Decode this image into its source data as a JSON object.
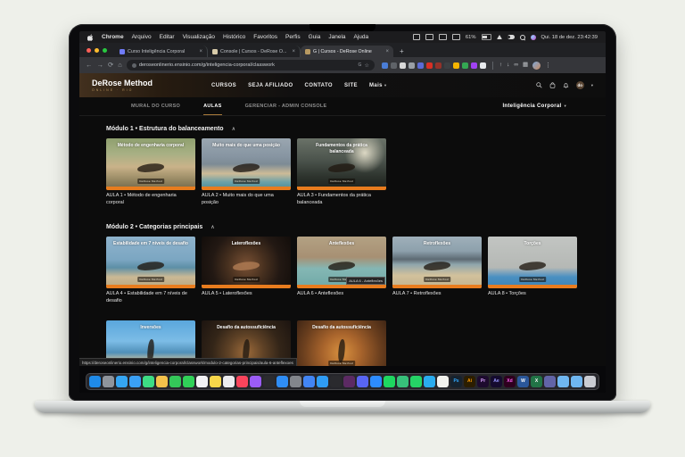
{
  "colors": {
    "accent_orange": "#e87c1e",
    "accent_gold": "#a87a3a"
  },
  "menubar": {
    "items": [
      "Chrome",
      "Arquivo",
      "Editar",
      "Visualização",
      "Histórico",
      "Favoritos",
      "Perfis",
      "Guia",
      "Janela",
      "Ajuda"
    ],
    "battery_pct": "61%",
    "clock": "Qui. 18 de dez. 23:42:39"
  },
  "browser": {
    "tabs": [
      {
        "title": "Curso Inteligência Corporal",
        "favicon": "#6f7bf7",
        "active": false
      },
      {
        "title": "Console | Cursos - DeRose O...",
        "favicon": "#d8cba9",
        "active": false
      },
      {
        "title": "G | Cursos - DeRose Online",
        "favicon": "#b89a62",
        "active": true
      }
    ],
    "url": "deroseonlinerio.ensinio.com/g/inteligencia-corporal/classwork",
    "key_hint": "G",
    "status_url": "https://deroseonlinerio.ensinio.com/g/inteligencia-corporal/classwork/modulo-2-categorias-principais/aula-6-anteflexoes",
    "extensions": [
      {
        "name": "ext-blue",
        "color": "#4a7dd6"
      },
      {
        "name": "ext-slate",
        "color": "#5f6368"
      },
      {
        "name": "ext-pencil",
        "color": "#d8d8d8"
      },
      {
        "name": "ext-gray",
        "color": "#9aa0a6"
      },
      {
        "name": "ext-indigo",
        "color": "#5b6bd6"
      },
      {
        "name": "ext-red",
        "color": "#d93025"
      },
      {
        "name": "ext-maroon",
        "color": "#93322a"
      },
      {
        "name": "ext-dark",
        "color": "#3c4043"
      },
      {
        "name": "ext-amber",
        "color": "#f4b400"
      },
      {
        "name": "ext-green",
        "color": "#34a853"
      },
      {
        "name": "ext-purple",
        "color": "#a142f4"
      },
      {
        "name": "ext-white",
        "color": "#e8eaed"
      }
    ]
  },
  "icons": {
    "back": "←",
    "forward": "→",
    "reload": "⟳",
    "home": "⌂",
    "new_tab": "+",
    "menu": "⋮",
    "star": "☆",
    "collapse": "∧",
    "dropdown": "▾",
    "share": "↑",
    "download": "↓",
    "link": "∞",
    "grid": "▦",
    "close": "×"
  },
  "site": {
    "logo": "DeRose Method",
    "logo_sub": "ONLINE · RIO",
    "nav": [
      "CURSOS",
      "SEJA AFILIADO",
      "CONTATO",
      "SITE"
    ],
    "more_label": "Mais",
    "avatar_label": "do",
    "course_tabs": [
      {
        "label": "MURAL DO CURSO",
        "active": false
      },
      {
        "label": "AULAS",
        "active": true
      },
      {
        "label": "GERENCIAR - ADMIN CONSOLE",
        "active": false
      }
    ],
    "course_selector": "Inteligência Corporal",
    "watermark": "DeRose Method",
    "modules": [
      {
        "title": "Módulo 1 • Estrutura do balanceamento",
        "lessons": [
          {
            "caption": "AULA 1 • Método de engenharia corporal",
            "thumb_title": "Método de engenharia corporal",
            "style": "t1",
            "tooltip": ""
          },
          {
            "caption": "AULA 2 • Muito mais do que uma posição",
            "thumb_title": "Muito mais do que uma posição",
            "style": "t2",
            "tooltip": ""
          },
          {
            "caption": "AULA 3 • Fundamentos da prática balanceada",
            "thumb_title": "Fundamentos da prática balanceada",
            "style": "t3",
            "tooltip": ""
          }
        ]
      },
      {
        "title": "Módulo 2 • Categorias principais",
        "lessons": [
          {
            "caption": "AULA 4 • Estabilidade em 7 níveis de desafio",
            "thumb_title": "Estabilidade em 7 níveis de desafio",
            "style": "t4",
            "tooltip": ""
          },
          {
            "caption": "AULA 5 • Lateroflexões",
            "thumb_title": "Lateroflexões",
            "style": "t5",
            "tooltip": ""
          },
          {
            "caption": "AULA 6 • Anteflexões",
            "thumb_title": "Anteflexões",
            "style": "t6",
            "tooltip": "AULA 6 - Anteflexões"
          },
          {
            "caption": "AULA 7 • Retroflexões",
            "thumb_title": "Retroflexões",
            "style": "t7",
            "tooltip": ""
          },
          {
            "caption": "AULA 8 • Torções",
            "thumb_title": "Torções",
            "style": "t8",
            "tooltip": ""
          },
          {
            "caption": "",
            "thumb_title": "Inversões",
            "style": "t9",
            "tooltip": ""
          },
          {
            "caption": "",
            "thumb_title": "Desafio da autossuficiência",
            "style": "t10",
            "tooltip": ""
          },
          {
            "caption": "",
            "thumb_title": "Desafio da autossuficiência",
            "style": "t11",
            "tooltip": ""
          }
        ]
      }
    ]
  },
  "dock": {
    "icons": [
      {
        "name": "finder",
        "color": "#1f8ae8"
      },
      {
        "name": "launchpad",
        "color": "#8f949c"
      },
      {
        "name": "safari",
        "color": "#35a5f2"
      },
      {
        "name": "mail",
        "color": "#3aa0f5"
      },
      {
        "name": "maps",
        "color": "#3ddc84"
      },
      {
        "name": "photos",
        "color": "#f3c14b"
      },
      {
        "name": "messages",
        "color": "#34c759"
      },
      {
        "name": "facetime",
        "color": "#30d158"
      },
      {
        "name": "calendar",
        "color": "#f2f2f4"
      },
      {
        "name": "notes",
        "color": "#f7d64a"
      },
      {
        "name": "reminders",
        "color": "#ececf0"
      },
      {
        "name": "music",
        "color": "#fa445c"
      },
      {
        "name": "podcasts",
        "color": "#9b5cf6"
      },
      {
        "name": "tv",
        "color": "#2b2b2e"
      },
      {
        "name": "appstore",
        "color": "#2f8df5"
      },
      {
        "name": "settings",
        "color": "#83868c"
      },
      {
        "name": "chrome",
        "color": "#4285f4"
      },
      {
        "name": "vscode",
        "color": "#2f9cf4"
      },
      {
        "name": "terminal",
        "color": "#2a2a2e"
      },
      {
        "name": "slack",
        "color": "#5c2a63"
      },
      {
        "name": "discord",
        "color": "#5865f2"
      },
      {
        "name": "zoom",
        "color": "#2d8cff"
      },
      {
        "name": "spotify",
        "color": "#1ed760"
      },
      {
        "name": "figma",
        "color": "#37c07a"
      },
      {
        "name": "whatsapp",
        "color": "#25d366"
      },
      {
        "name": "telegram",
        "color": "#2aabee"
      },
      {
        "name": "notion",
        "color": "#f1f1ee"
      },
      {
        "name": "photoshop",
        "color": "#16222e",
        "label": "Ps",
        "label_color": "#31a8ff"
      },
      {
        "name": "illustrator",
        "color": "#2b1d00",
        "label": "Ai",
        "label_color": "#ff9a00"
      },
      {
        "name": "premiere",
        "color": "#1d0b2e",
        "label": "Pr",
        "label_color": "#d8a1ff"
      },
      {
        "name": "aftereffects",
        "color": "#150b2e",
        "label": "Ae",
        "label_color": "#9999ff"
      },
      {
        "name": "xd",
        "color": "#2e001e",
        "label": "Xd",
        "label_color": "#ff61f6"
      },
      {
        "name": "word",
        "color": "#2b579a",
        "label": "W",
        "label_color": "#ffffff"
      },
      {
        "name": "excel",
        "color": "#217346",
        "label": "X",
        "label_color": "#ffffff"
      },
      {
        "name": "teams",
        "color": "#6264a7"
      },
      {
        "name": "folder",
        "color": "#6fb6f0"
      },
      {
        "name": "downloads",
        "color": "#6fb6f0"
      },
      {
        "name": "trash",
        "color": "#caccd2"
      }
    ]
  }
}
